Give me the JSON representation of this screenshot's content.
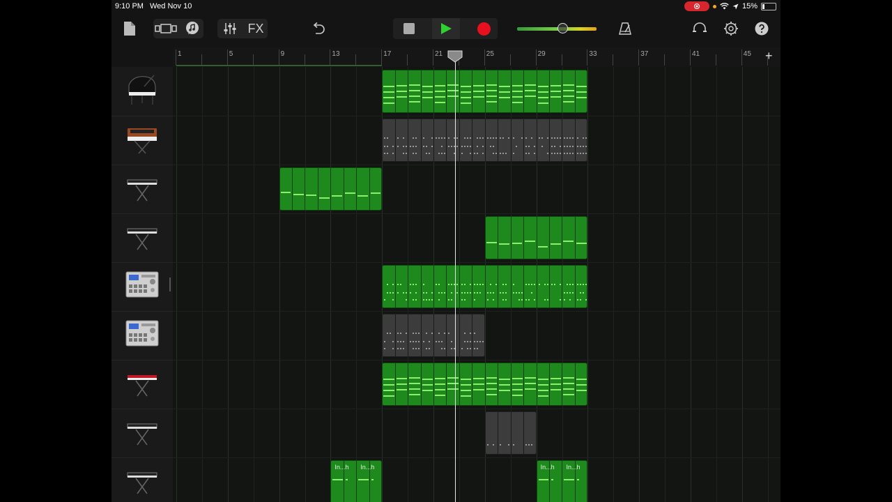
{
  "status_bar": {
    "time": "9:10 PM",
    "date": "Wed Nov 10",
    "battery": "15%"
  },
  "toolbar": {
    "my_songs_icon": "document-icon",
    "view_icon": "tracks-view-icon",
    "loops_icon": "loop-browser-icon",
    "mixer_icon": "mixer-sliders-icon",
    "fx_label": "FX",
    "undo_icon": "undo-icon",
    "stop_icon": "stop-icon",
    "play_icon": "play-icon",
    "record_icon": "record-icon",
    "master_volume": 0.57,
    "metronome_icon": "metronome-icon",
    "headphones_icon": "headphones-icon",
    "settings_icon": "gear-icon",
    "help_icon": "help-icon",
    "accent": "#2fd02f",
    "record_color": "#e8101e"
  },
  "ruler": {
    "bar_labels": [
      "1",
      "5",
      "9",
      "13",
      "17",
      "21",
      "25",
      "29",
      "33",
      "37",
      "41",
      "45"
    ],
    "add_label": "+",
    "playhead_bar": 22
  },
  "tracks": [
    {
      "instrument": "grand-piano-icon",
      "regions": [
        {
          "start": 17,
          "end": 33,
          "color": "green",
          "pattern": "chords"
        }
      ]
    },
    {
      "instrument": "vintage-synth-icon",
      "regions": [
        {
          "start": 17,
          "end": 33,
          "color": "gray",
          "pattern": "dots"
        }
      ]
    },
    {
      "instrument": "keyboard-icon",
      "regions": [
        {
          "start": 9,
          "end": 17,
          "color": "green",
          "pattern": "melody"
        }
      ]
    },
    {
      "instrument": "keyboard-icon",
      "regions": [
        {
          "start": 25,
          "end": 33,
          "color": "green",
          "pattern": "melody2"
        }
      ]
    },
    {
      "instrument": "drum-machine-icon",
      "regions": [
        {
          "start": 17,
          "end": 33,
          "color": "green",
          "pattern": "drums"
        }
      ]
    },
    {
      "instrument": "drum-machine-icon",
      "regions": [
        {
          "start": 17,
          "end": 25,
          "color": "gray",
          "pattern": "drums"
        }
      ]
    },
    {
      "instrument": "red-keyboard-icon",
      "regions": [
        {
          "start": 17,
          "end": 33,
          "color": "green",
          "pattern": "chords"
        }
      ]
    },
    {
      "instrument": "keyboard-stand-icon",
      "regions": [
        {
          "start": 25,
          "end": 29,
          "color": "gray",
          "pattern": "sparse"
        }
      ]
    },
    {
      "instrument": "keyboard-stand-icon",
      "regions": [
        {
          "start": 13,
          "end": 17,
          "color": "green",
          "pattern": "named",
          "name": "In...h"
        },
        {
          "start": 29,
          "end": 33,
          "color": "green",
          "pattern": "named",
          "name": "In...h"
        }
      ]
    }
  ]
}
